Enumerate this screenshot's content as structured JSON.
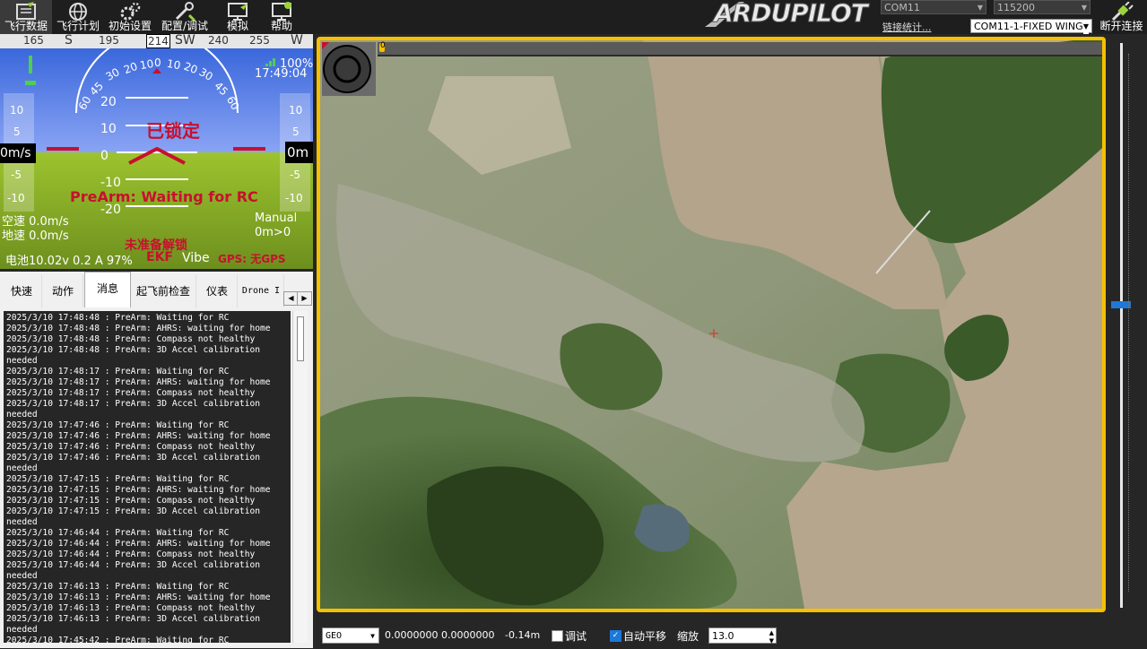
{
  "toolbar": {
    "items": [
      {
        "label": "飞行数据",
        "icon": "flight-data-icon"
      },
      {
        "label": "飞行计划",
        "icon": "globe-icon"
      },
      {
        "label": "初始设置",
        "icon": "gears-icon"
      },
      {
        "label": "配置/调试",
        "icon": "wrench-icon"
      },
      {
        "label": "模拟",
        "icon": "monitor-icon"
      },
      {
        "label": "帮助",
        "icon": "help-monitor-icon"
      }
    ],
    "logo": "ARDUPILOT",
    "port": "COM11",
    "baud": "115200",
    "link_stats": "链接统计...",
    "profile": "COM11-1-FIXED WING",
    "disconnect": "断开连接"
  },
  "hud": {
    "heading_ticks": [
      "165",
      "S",
      "195",
      "214",
      "SW",
      "240",
      "255",
      "W"
    ],
    "pitch_labels": [
      "20",
      "10",
      "0",
      "-10",
      "-20"
    ],
    "roll_labels": [
      "60",
      "45",
      "30",
      "20",
      "10",
      "0",
      "10",
      "20",
      "30",
      "45",
      "60"
    ],
    "left_scale": [
      "10",
      "5",
      "-5",
      "-10"
    ],
    "right_scale": [
      "10",
      "5",
      "-5",
      "-10"
    ],
    "speed": "0m/s",
    "alt": "0m",
    "battery_pct": "100%",
    "clock": "17:49:04",
    "locked": "已锁定",
    "prearm": "PreArm: Waiting for RC",
    "airspeed": "空速 0.0m/s",
    "groundspeed": "地速 0.0m/s",
    "mode": "Manual",
    "mode_sub": "0m>0",
    "not_ready": "未准备解锁",
    "battery": "电池10.02v 0.2 A 97%",
    "ekf": "EKF",
    "vibe": "Vibe",
    "gps": "GPS: 无GPS"
  },
  "tabs": [
    "快速",
    "动作",
    "消息",
    "起飞前检查",
    "仪表",
    "Drone I"
  ],
  "messages": [
    "2025/3/10 17:48:48 : PreArm: Waiting for RC",
    "2025/3/10 17:48:48 : PreArm: AHRS: waiting for home",
    "2025/3/10 17:48:48 : PreArm: Compass not healthy",
    "2025/3/10 17:48:48 : PreArm: 3D Accel calibration",
    "needed",
    "2025/3/10 17:48:17 : PreArm: Waiting for RC",
    "2025/3/10 17:48:17 : PreArm: AHRS: waiting for home",
    "2025/3/10 17:48:17 : PreArm: Compass not healthy",
    "2025/3/10 17:48:17 : PreArm: 3D Accel calibration",
    "needed",
    "2025/3/10 17:47:46 : PreArm: Waiting for RC",
    "2025/3/10 17:47:46 : PreArm: AHRS: waiting for home",
    "2025/3/10 17:47:46 : PreArm: Compass not healthy",
    "2025/3/10 17:47:46 : PreArm: 3D Accel calibration",
    "needed",
    "2025/3/10 17:47:15 : PreArm: Waiting for RC",
    "2025/3/10 17:47:15 : PreArm: AHRS: waiting for home",
    "2025/3/10 17:47:15 : PreArm: Compass not healthy",
    "2025/3/10 17:47:15 : PreArm: 3D Accel calibration",
    "needed",
    "2025/3/10 17:46:44 : PreArm: Waiting for RC",
    "2025/3/10 17:46:44 : PreArm: AHRS: waiting for home",
    "2025/3/10 17:46:44 : PreArm: Compass not healthy",
    "2025/3/10 17:46:44 : PreArm: 3D Accel calibration",
    "needed",
    "2025/3/10 17:46:13 : PreArm: Waiting for RC",
    "2025/3/10 17:46:13 : PreArm: AHRS: waiting for home",
    "2025/3/10 17:46:13 : PreArm: Compass not healthy",
    "2025/3/10 17:46:13 : PreArm: 3D Accel calibration",
    "needed",
    "2025/3/10 17:45:42 : PreArm: Waiting for RC"
  ],
  "statusbar": {
    "coord_type": "GEO",
    "coords": "0.0000000 0.0000000",
    "alt": "-0.14m",
    "debug_label": "调试",
    "debug_checked": false,
    "autopan_label": "自动平移",
    "autopan_checked": true,
    "zoom_label": "缩放",
    "zoom_value": "13.0"
  },
  "map": {
    "progress_label": "0"
  },
  "colors": {
    "accent": "#f6c000",
    "hud_red": "#c8102e",
    "sky": "#3a6cd8",
    "ground": "#7aa51f"
  }
}
